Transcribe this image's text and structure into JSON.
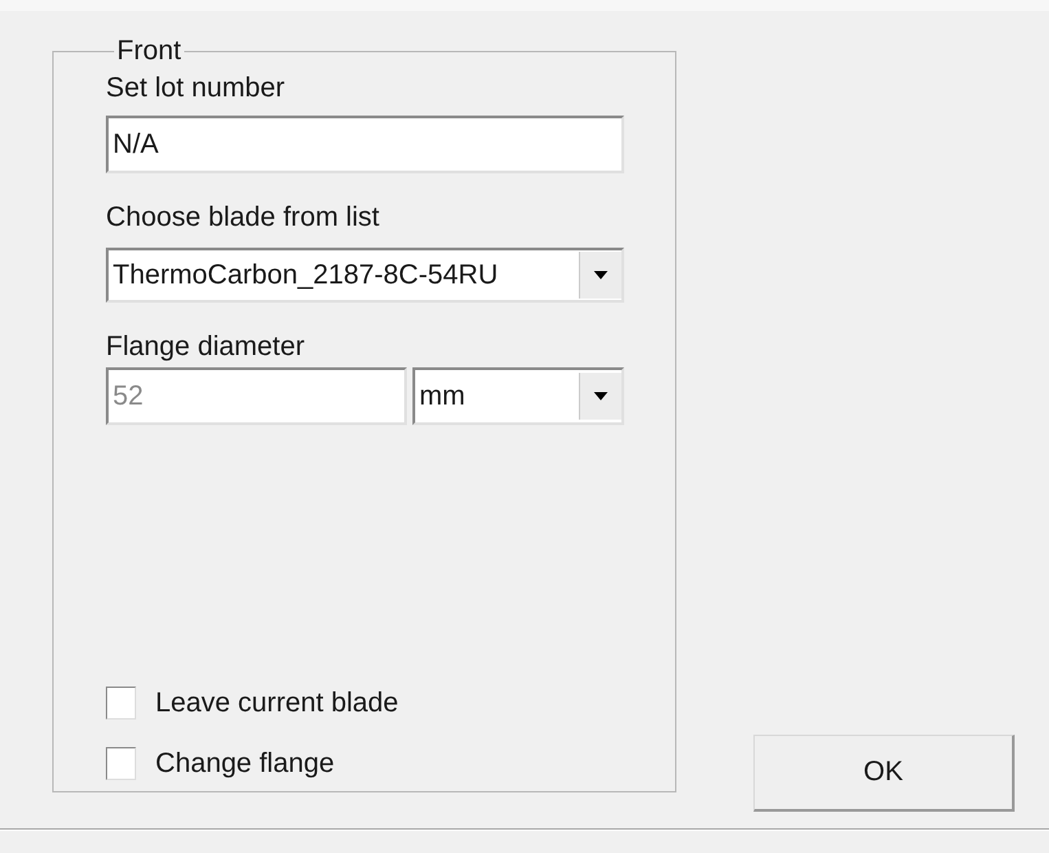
{
  "group": {
    "title": "Front"
  },
  "lot": {
    "label": "Set lot number",
    "value": "N/A"
  },
  "blade": {
    "label": "Choose blade from list",
    "value": "ThermoCarbon_2187-8C-54RU"
  },
  "flange": {
    "label": "Flange diameter",
    "value": "52",
    "disabled": true,
    "unit": "mm"
  },
  "checkboxes": [
    {
      "label": "Leave current blade",
      "checked": false
    },
    {
      "label": "Change flange",
      "checked": false
    }
  ],
  "ok_button": "OK"
}
